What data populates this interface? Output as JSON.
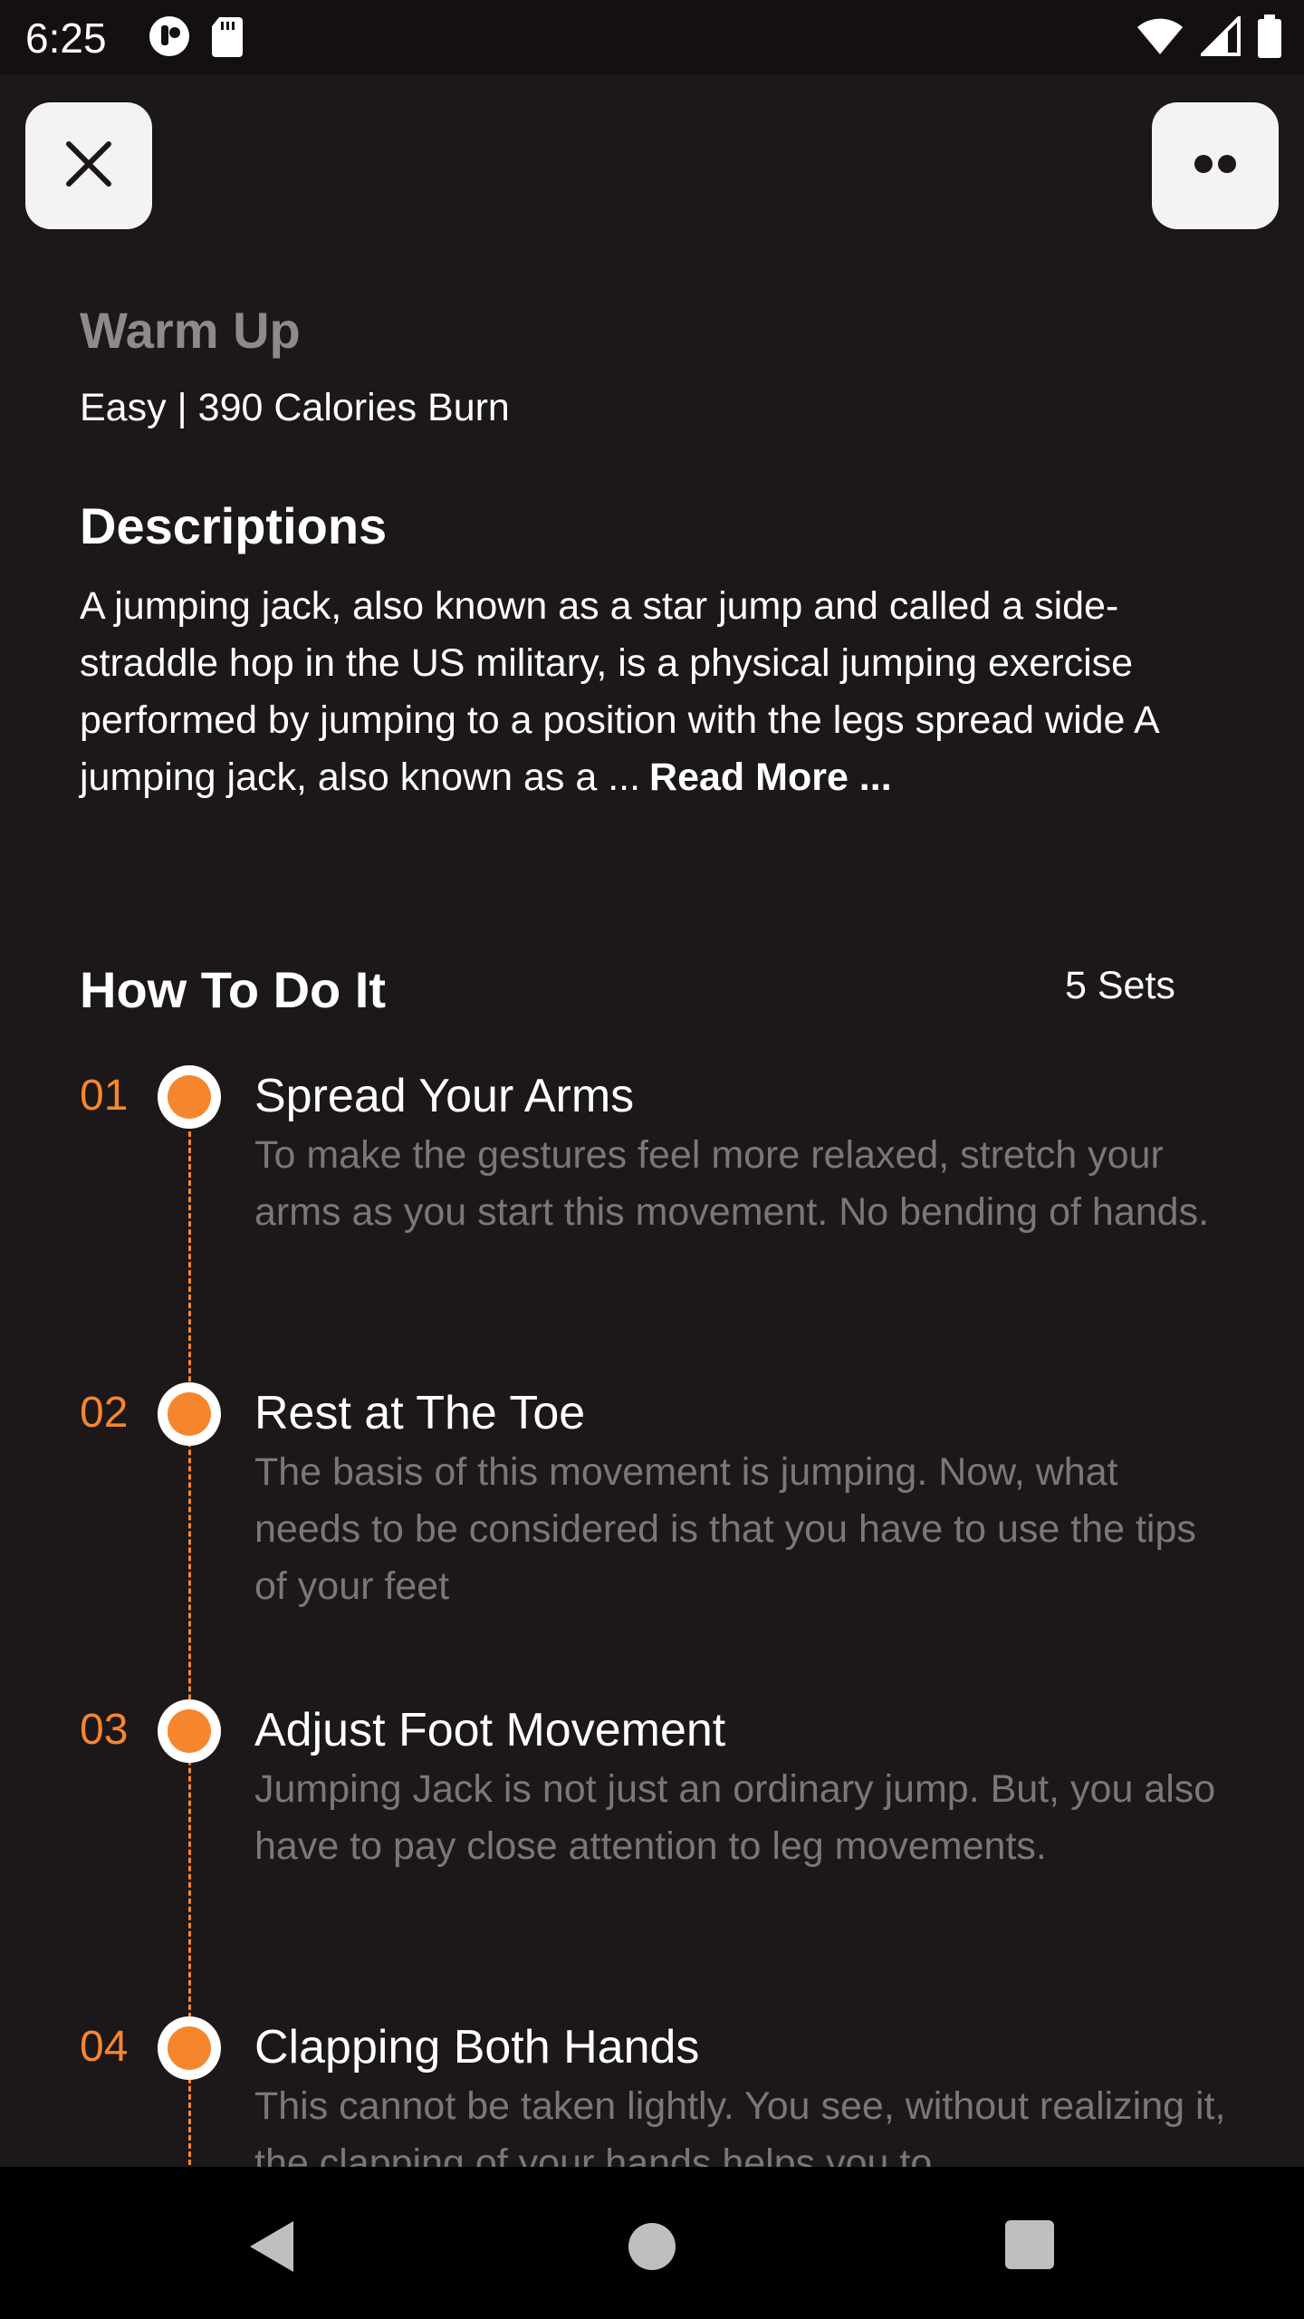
{
  "status_bar": {
    "time": "6:25",
    "icons_left": [
      "notification-app-icon",
      "sd-card-icon"
    ],
    "icons_right": [
      "wifi-icon",
      "cellular-signal-icon",
      "battery-icon"
    ]
  },
  "header": {
    "close_icon": "close-icon",
    "more_icon": "more-dots-icon"
  },
  "workout": {
    "title": "Warm Up",
    "meta": "Easy | 390 Calories Burn"
  },
  "descriptions": {
    "title": "Descriptions",
    "text": "A jumping jack, also known as a star jump and called a side-straddle hop in the US military, is a physical jumping exercise performed by jumping to a position with the legs spread wide A jumping jack, also known as a ...",
    "read_more": "Read More ..."
  },
  "how_to": {
    "title": "How To Do It",
    "sets": "5 Sets",
    "steps": [
      {
        "number": "01",
        "title": "Spread Your Arms",
        "desc": "To make the gestures feel more relaxed, stretch your arms as you start this movement. No bending of hands."
      },
      {
        "number": "02",
        "title": "Rest at The Toe",
        "desc": "The basis of this movement is jumping. Now, what needs to be considered is that you have to use the tips of your feet"
      },
      {
        "number": "03",
        "title": "Adjust Foot Movement",
        "desc": "Jumping Jack is not just an ordinary jump. But, you also have to pay close attention to leg movements."
      },
      {
        "number": "04",
        "title": "Clapping Both Hands",
        "desc": "This cannot be taken lightly. You see, without realizing it, the clapping of your hands helps you to"
      }
    ]
  },
  "colors": {
    "accent": "#f6862e",
    "background": "#1c1718",
    "muted_text": "#7b7777",
    "button_bg": "#f3f4f2"
  },
  "nav_bar": {
    "icons": [
      "back-icon",
      "home-icon",
      "recents-icon"
    ]
  }
}
